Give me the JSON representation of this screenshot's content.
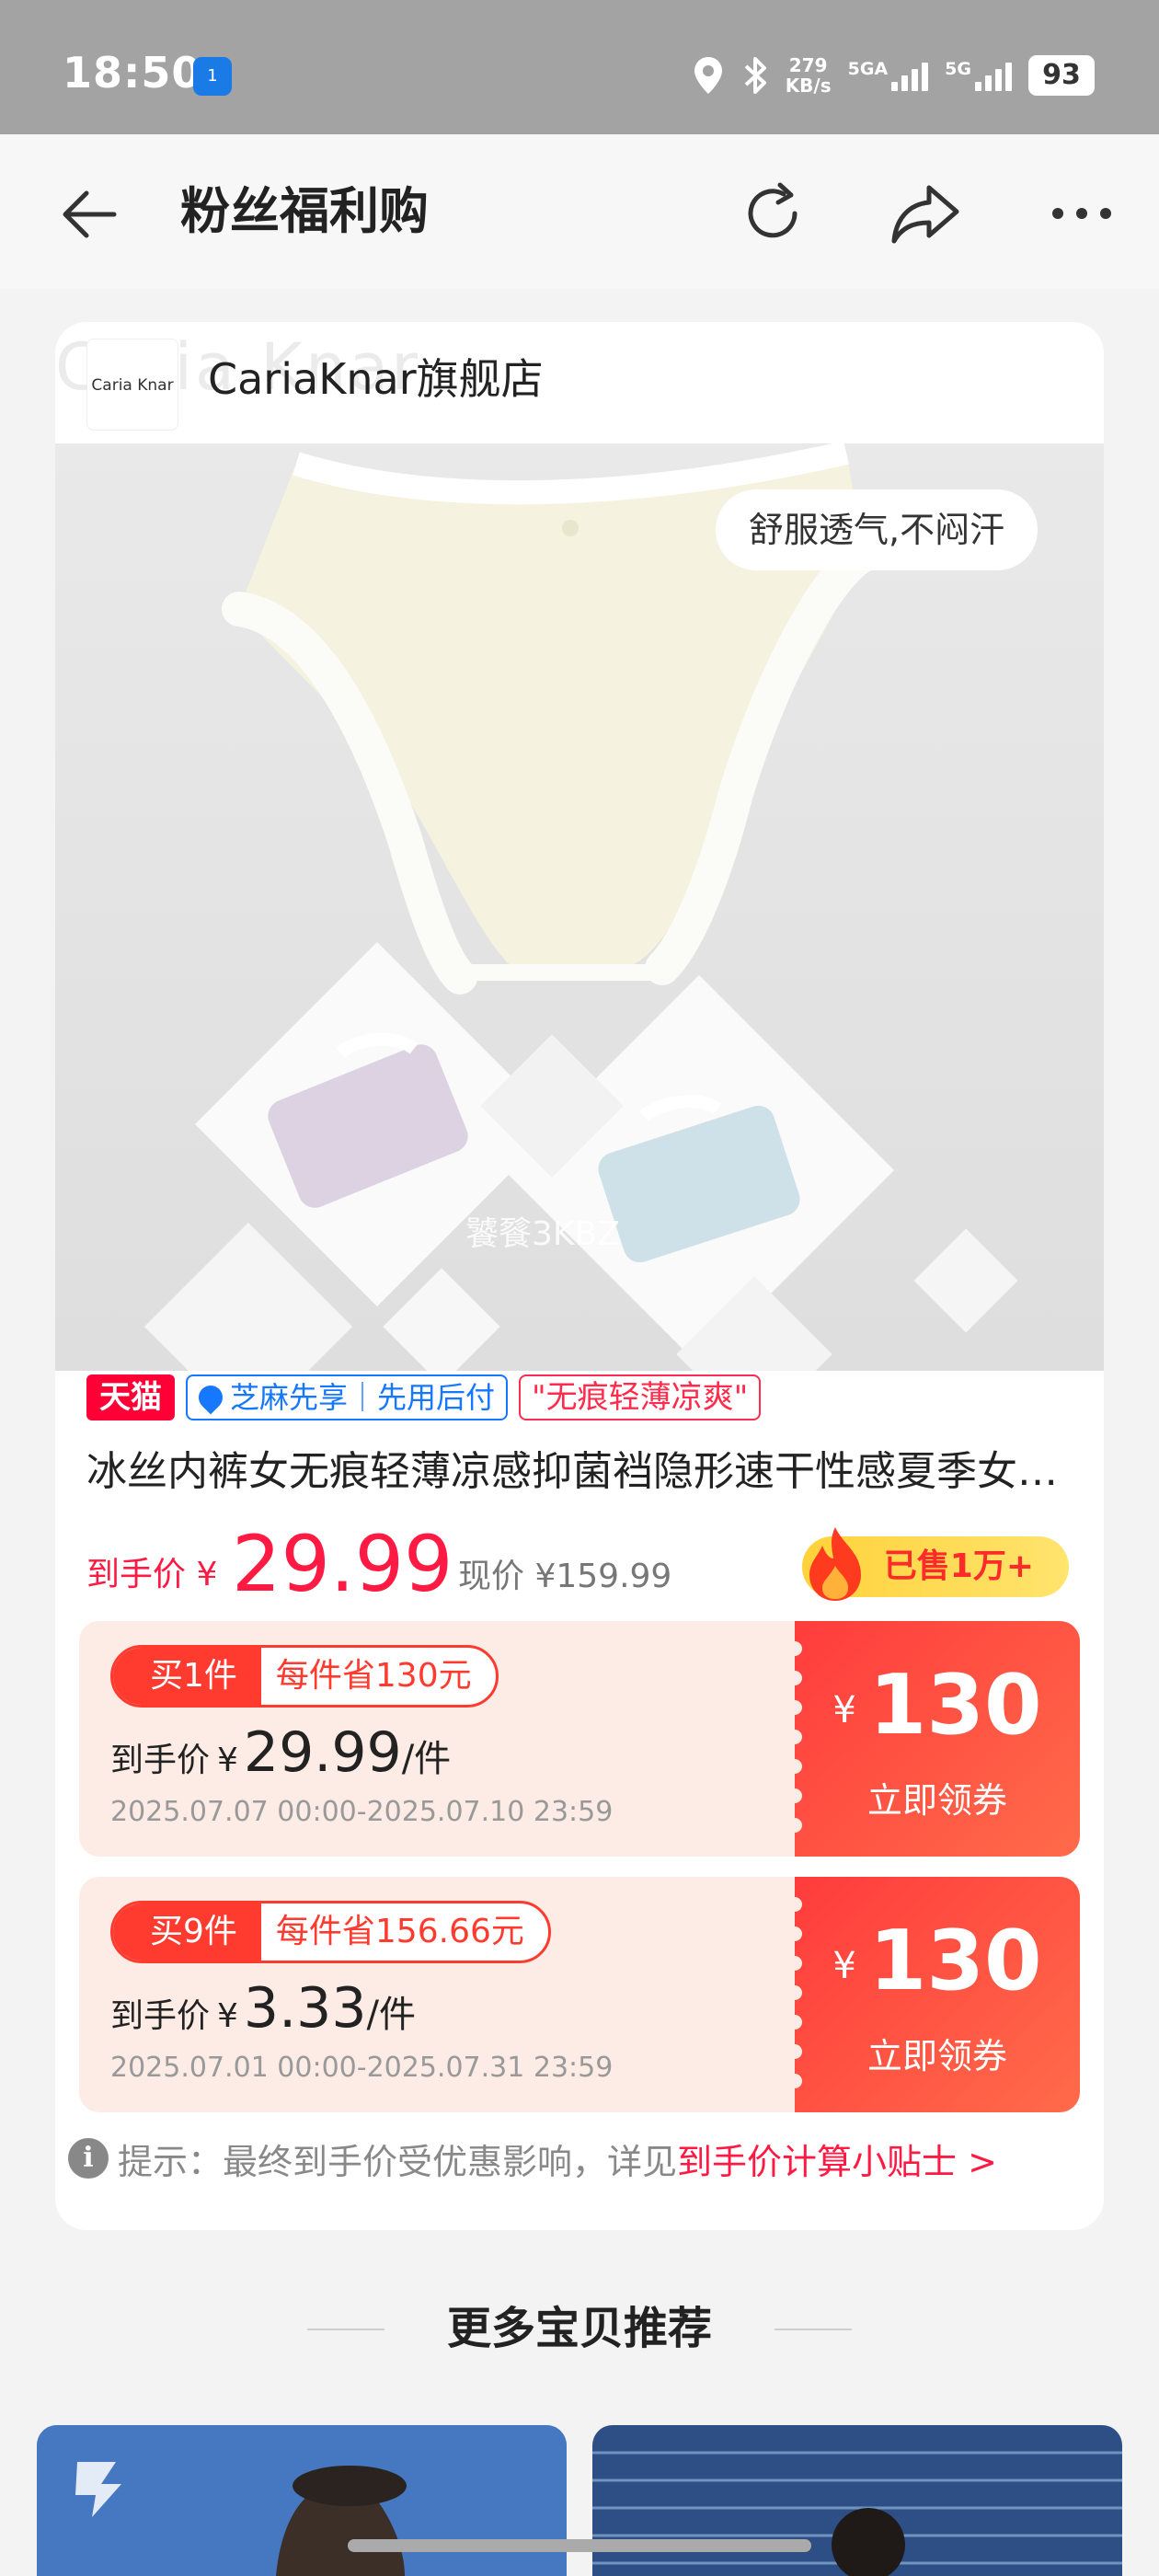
{
  "status_bar": {
    "time": "18:50",
    "hotspot_label": "1",
    "net_speed_value": "279",
    "net_speed_unit": "KB/s",
    "network_1": "5GA",
    "network_2": "5G",
    "battery": "93",
    "icons": [
      "hotspot-icon",
      "location-icon",
      "bluetooth-icon",
      "signal-icon",
      "battery-icon"
    ]
  },
  "nav": {
    "title": "粉丝福利购",
    "icons": [
      "back-arrow-icon",
      "refresh-icon",
      "share-icon",
      "more-icon"
    ]
  },
  "store": {
    "logo_text": "Caria Knar",
    "background_text": "Caria Knar",
    "name": "CariaKnar旗舰店"
  },
  "product": {
    "feature_tag": "舒服透气,不闷汗",
    "image_watermark": "饕餮3KBZ",
    "tags": {
      "platform": "天猫",
      "payment": "芝麻先享｜先用后付",
      "promo": "\"无痕轻薄凉爽\""
    },
    "title": "冰丝内裤女无痕轻薄凉感抑菌裆隐形速干性感夏季女士内裤",
    "final_price_label": "到手价",
    "currency": "¥",
    "final_price": "29.99",
    "current_price_label": "现价",
    "current_price": "¥159.99",
    "sold": "已售1万+"
  },
  "coupons": [
    {
      "qty_label": "买1件",
      "save_label": "每件省130元",
      "price_label": "到手价",
      "currency": "¥",
      "price": "29.99",
      "unit": "/件",
      "validity": "2025.07.07 00:00-2025.07.10 23:59",
      "coupon_currency": "¥",
      "coupon_amount": "130",
      "button_label": "立即领券"
    },
    {
      "qty_label": "买9件",
      "save_label": "每件省156.66元",
      "price_label": "到手价",
      "currency": "¥",
      "price": "3.33",
      "unit": "/件",
      "validity": "2025.07.01 00:00-2025.07.31 23:59",
      "coupon_currency": "¥",
      "coupon_amount": "130",
      "button_label": "立即领券"
    }
  ],
  "tip": {
    "icon": "info-icon",
    "text": "提示：最终到手价受优惠影响，详见",
    "link_text": "到手价计算小贴士 >"
  },
  "recommend": {
    "title": "更多宝贝推荐"
  },
  "colors": {
    "accent_red": "#ff1a43",
    "coupon_bg": "#fdece6",
    "coupon_button": "#ff4040",
    "alipay_blue": "#1677ff",
    "sold_yellow": "#ffd23a"
  }
}
